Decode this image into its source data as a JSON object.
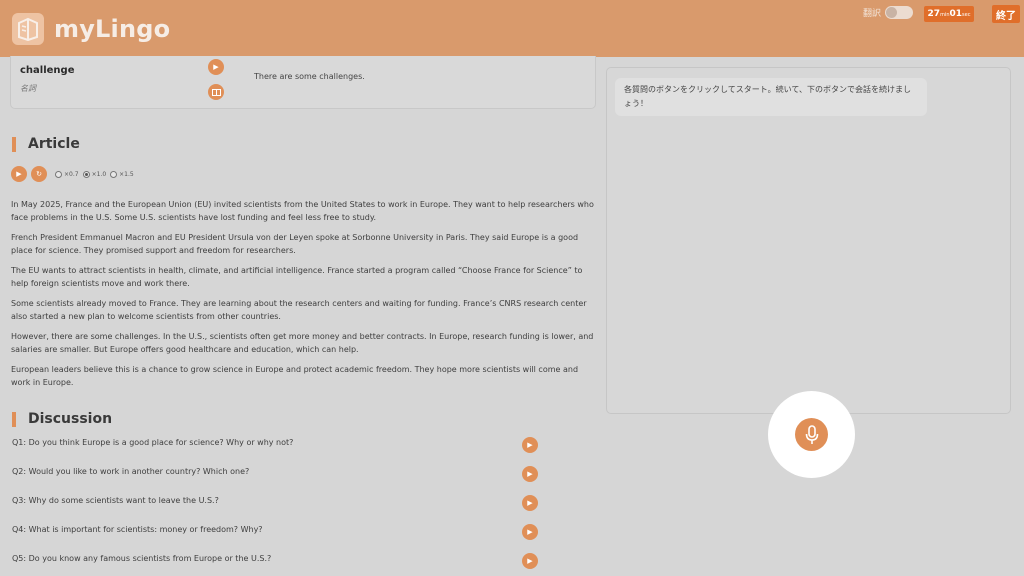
{
  "header": {
    "app_name": "myLingo",
    "translate_label": "翻訳",
    "timer_min": "27",
    "timer_min_unit": "min",
    "timer_sec": "01",
    "timer_sec_unit": "sec",
    "end_label": "終了",
    "accent": "#e06e2a"
  },
  "vocab": {
    "word": "challenge",
    "pos": "名詞",
    "example": "There are some challenges."
  },
  "article": {
    "title": "Article",
    "speeds": [
      {
        "label": "×0.7",
        "selected": false
      },
      {
        "label": "×1.0",
        "selected": true
      },
      {
        "label": "×1.5",
        "selected": false
      }
    ],
    "paragraphs": [
      "In May 2025, France and the European Union (EU) invited scientists from the United States to work in Europe. They want to help researchers who face problems in the U.S. Some U.S. scientists have lost funding and feel less free to study.",
      "French President Emmanuel Macron and EU President Ursula von der Leyen spoke at Sorbonne University in Paris. They said Europe is a good place for science. They promised support and freedom for researchers.",
      "The EU wants to attract scientists in health, climate, and artificial intelligence. France started a program called “Choose France for Science” to help foreign scientists move and work there.",
      "Some scientists already moved to France. They are learning about the research centers and waiting for funding. France’s CNRS research center also started a new plan to welcome scientists from other countries.",
      "However, there are some challenges. In the U.S., scientists often get more money and better contracts. In Europe, research funding is lower, and salaries are smaller. But Europe offers good healthcare and education, which can help.",
      "European leaders believe this is a chance to grow science in Europe and protect academic freedom. They hope more scientists will come and work in Europe."
    ]
  },
  "discussion": {
    "title": "Discussion",
    "questions": [
      "Q1: Do you think Europe is a good place for science? Why or why not?",
      "Q2: Would you like to work in another country? Which one?",
      "Q3: Why do some scientists want to leave the U.S.?",
      "Q4: What is important for scientists: money or freedom? Why?",
      "Q5: Do you know any famous scientists from Europe or the U.S.?"
    ]
  },
  "chat": {
    "message": "各質問のボタンをクリックしてスタート。続いて、下のボタンで会話を続けましょう！"
  },
  "icons": {
    "logo": "book-icon",
    "play": "play-icon",
    "replay": "replay-icon",
    "card": "flashcard-icon",
    "mic": "microphone-icon"
  }
}
